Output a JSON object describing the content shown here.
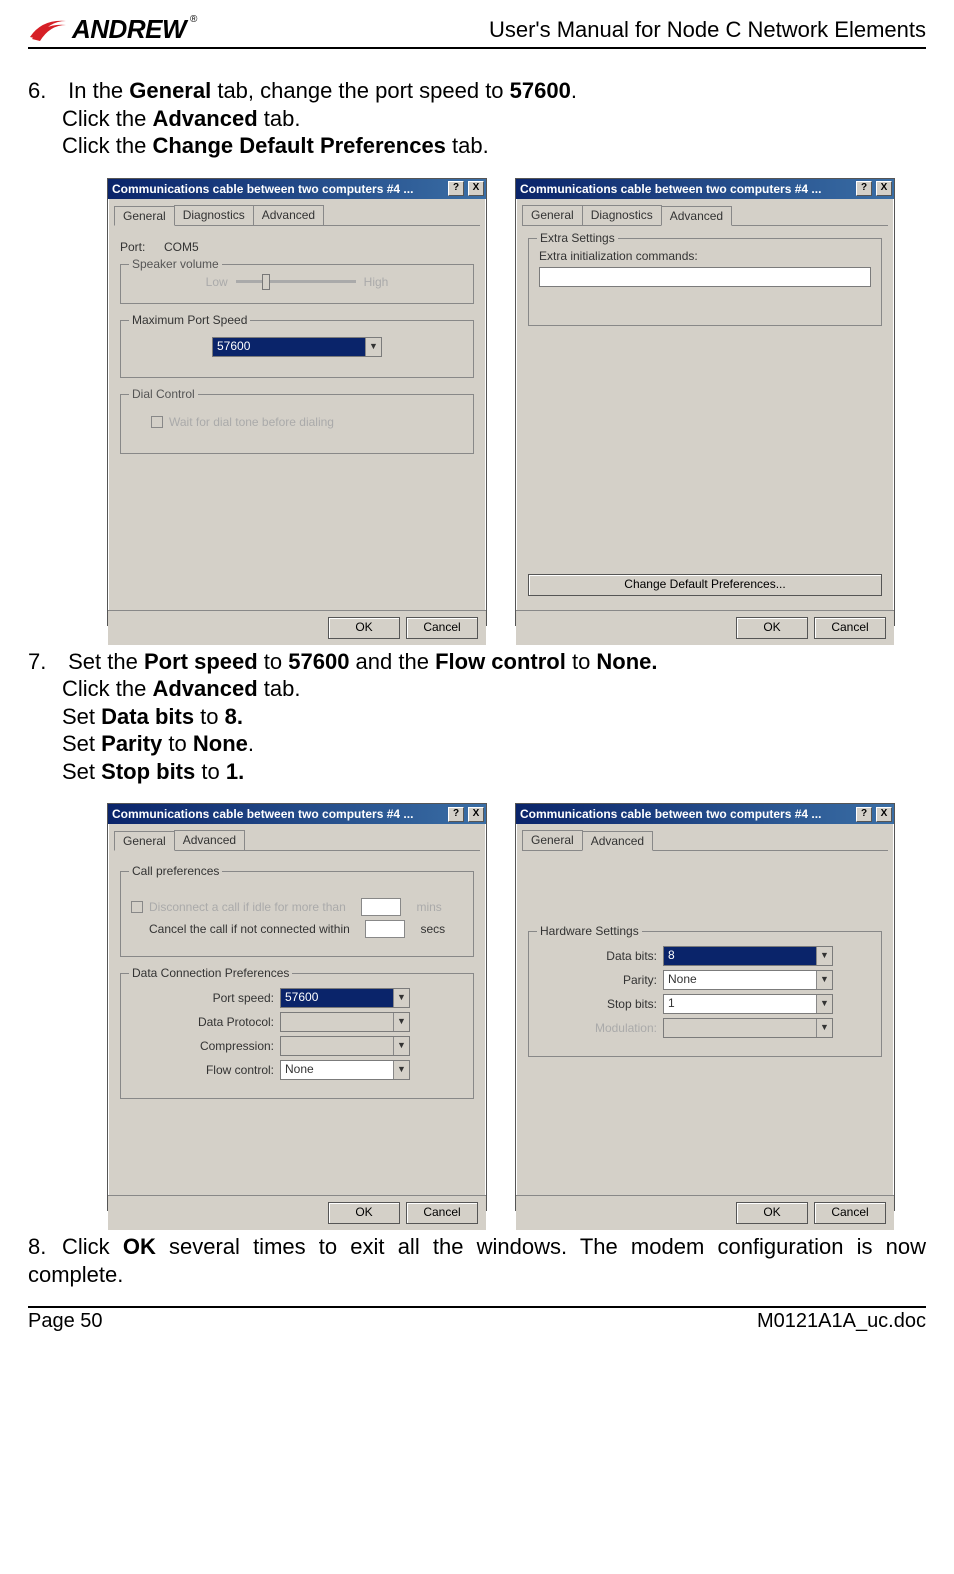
{
  "header": {
    "brand": "ANDREW",
    "title": "User's Manual for Node C Network Elements"
  },
  "steps": {
    "s6": {
      "num": "6.",
      "l1a": "In the ",
      "l1b": "General",
      "l1c": " tab, change the port speed to ",
      "l1d": "57600",
      "l1e": ".",
      "l2a": "Click the ",
      "l2b": "Advanced",
      "l2c": " tab.",
      "l3a": "Click the ",
      "l3b": "Change Default Preferences",
      "l3c": " tab."
    },
    "s7": {
      "num": "7.",
      "l1a": "Set the ",
      "l1b": "Port speed",
      "l1c": " to ",
      "l1d": "57600",
      "l1e": " and the ",
      "l1f": "Flow control",
      "l1g": " to ",
      "l1h": "None.",
      "l2a": "Click the ",
      "l2b": "Advanced",
      "l2c": " tab.",
      "l3a": "Set ",
      "l3b": "Data bits",
      "l3c": " to ",
      "l3d": "8.",
      "l4a": "Set ",
      "l4b": "Parity",
      "l4c": " to ",
      "l4d": "None",
      "l4e": ".",
      "l5a": "Set ",
      "l5b": "Stop bits",
      "l5c": " to ",
      "l5d": "1."
    },
    "s8": {
      "num": "8.",
      "l1a": "Click ",
      "l1b": "OK",
      "l1c": " several times to exit all the windows. The modem configuration is now complete."
    }
  },
  "win": {
    "title": "Communications cable between two computers #4 ...",
    "tabs": {
      "general": "General",
      "diagnostics": "Diagnostics",
      "advanced": "Advanced"
    },
    "btn": {
      "ok": "OK",
      "cancel": "Cancel",
      "help": "?",
      "close": "X"
    }
  },
  "dlg1": {
    "port_label": "Port:",
    "port_value": "COM5",
    "grp_speaker": "Speaker volume",
    "low": "Low",
    "high": "High",
    "grp_maxport": "Maximum Port Speed",
    "maxport_value": "57600",
    "grp_dial": "Dial Control",
    "dial_check": "Wait for dial tone before dialing"
  },
  "dlg2": {
    "grp_extra": "Extra Settings",
    "extra_label": "Extra initialization commands:",
    "change_btn": "Change Default Preferences..."
  },
  "dlg3": {
    "grp_callpref": "Call preferences",
    "disc_label": "Disconnect a call if idle for more than",
    "mins": "mins",
    "cancel_label": "Cancel the call if not connected within",
    "secs": "secs",
    "grp_dcp": "Data Connection Preferences",
    "portspeed_label": "Port speed:",
    "portspeed_value": "57600",
    "proto_label": "Data Protocol:",
    "comp_label": "Compression:",
    "flow_label": "Flow control:",
    "flow_value": "None"
  },
  "dlg4": {
    "grp_hw": "Hardware Settings",
    "databits_label": "Data bits:",
    "databits_value": "8",
    "parity_label": "Parity:",
    "parity_value": "None",
    "stopbits_label": "Stop bits:",
    "stopbits_value": "1",
    "mod_label": "Modulation:"
  },
  "footer": {
    "page": "Page 50",
    "doc": "M0121A1A_uc.doc"
  }
}
